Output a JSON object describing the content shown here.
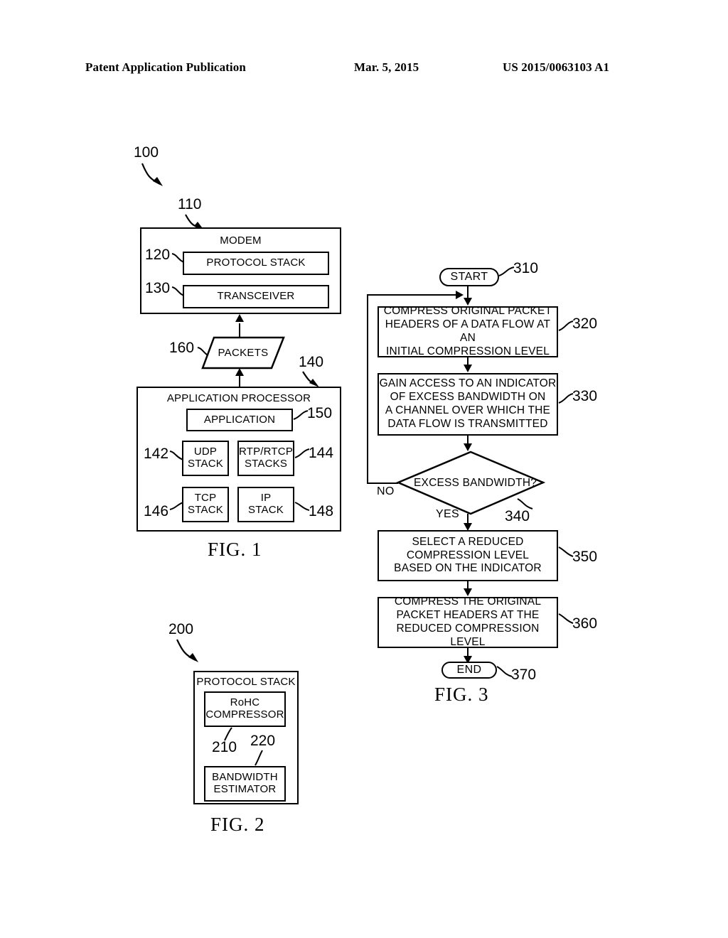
{
  "header": {
    "left": "Patent Application Publication",
    "center": "Mar. 5, 2015",
    "right": "US 2015/0063103 A1"
  },
  "fig1": {
    "caption": "FIG. 1",
    "system_ref": "100",
    "modem": {
      "ref": "110",
      "title": "MODEM",
      "protocol_stack": {
        "ref": "120",
        "label": "PROTOCOL STACK"
      },
      "transceiver": {
        "ref": "130",
        "label": "TRANSCEIVER"
      }
    },
    "packets": {
      "ref": "160",
      "label": "PACKETS"
    },
    "app_processor": {
      "ref": "140",
      "title": "APPLICATION PROCESSOR",
      "application": {
        "ref": "150",
        "label": "APPLICATION"
      },
      "stacks": [
        {
          "ref": "142",
          "line1": "UDP",
          "line2": "STACK"
        },
        {
          "ref": "144",
          "line1": "RTP/RTCP",
          "line2": "STACKS"
        },
        {
          "ref": "146",
          "line1": "TCP",
          "line2": "STACK"
        },
        {
          "ref": "148",
          "line1": "IP",
          "line2": "STACK"
        }
      ]
    }
  },
  "fig2": {
    "caption": "FIG. 2",
    "system_ref": "200",
    "title": "PROTOCOL STACK",
    "rohc": {
      "ref": "210",
      "line1": "RoHC",
      "line2": "COMPRESSOR"
    },
    "bandwidth": {
      "ref": "220",
      "line1": "BANDWIDTH",
      "line2": "ESTIMATOR"
    }
  },
  "fig3": {
    "caption": "FIG. 3",
    "start": {
      "ref": "310",
      "label": "START"
    },
    "step320": {
      "ref": "320",
      "lines": [
        "COMPRESS ORIGINAL PACKET",
        "HEADERS OF A DATA FLOW AT AN",
        "INITIAL COMPRESSION LEVEL"
      ]
    },
    "step330": {
      "ref": "330",
      "lines": [
        "GAIN ACCESS TO AN INDICATOR",
        "OF EXCESS BANDWIDTH ON",
        "A CHANNEL OVER WHICH THE",
        "DATA FLOW IS TRANSMITTED"
      ]
    },
    "decision340": {
      "ref": "340",
      "label": "EXCESS BANDWIDTH?",
      "yes_label": "YES",
      "no_label": "NO"
    },
    "step350": {
      "ref": "350",
      "lines": [
        "SELECT A REDUCED",
        "COMPRESSION LEVEL",
        "BASED ON THE INDICATOR"
      ]
    },
    "step360": {
      "ref": "360",
      "lines": [
        "COMPRESS THE ORIGINAL",
        "PACKET HEADERS AT THE",
        "REDUCED COMPRESSION LEVEL"
      ]
    },
    "end": {
      "ref": "370",
      "label": "END"
    }
  }
}
